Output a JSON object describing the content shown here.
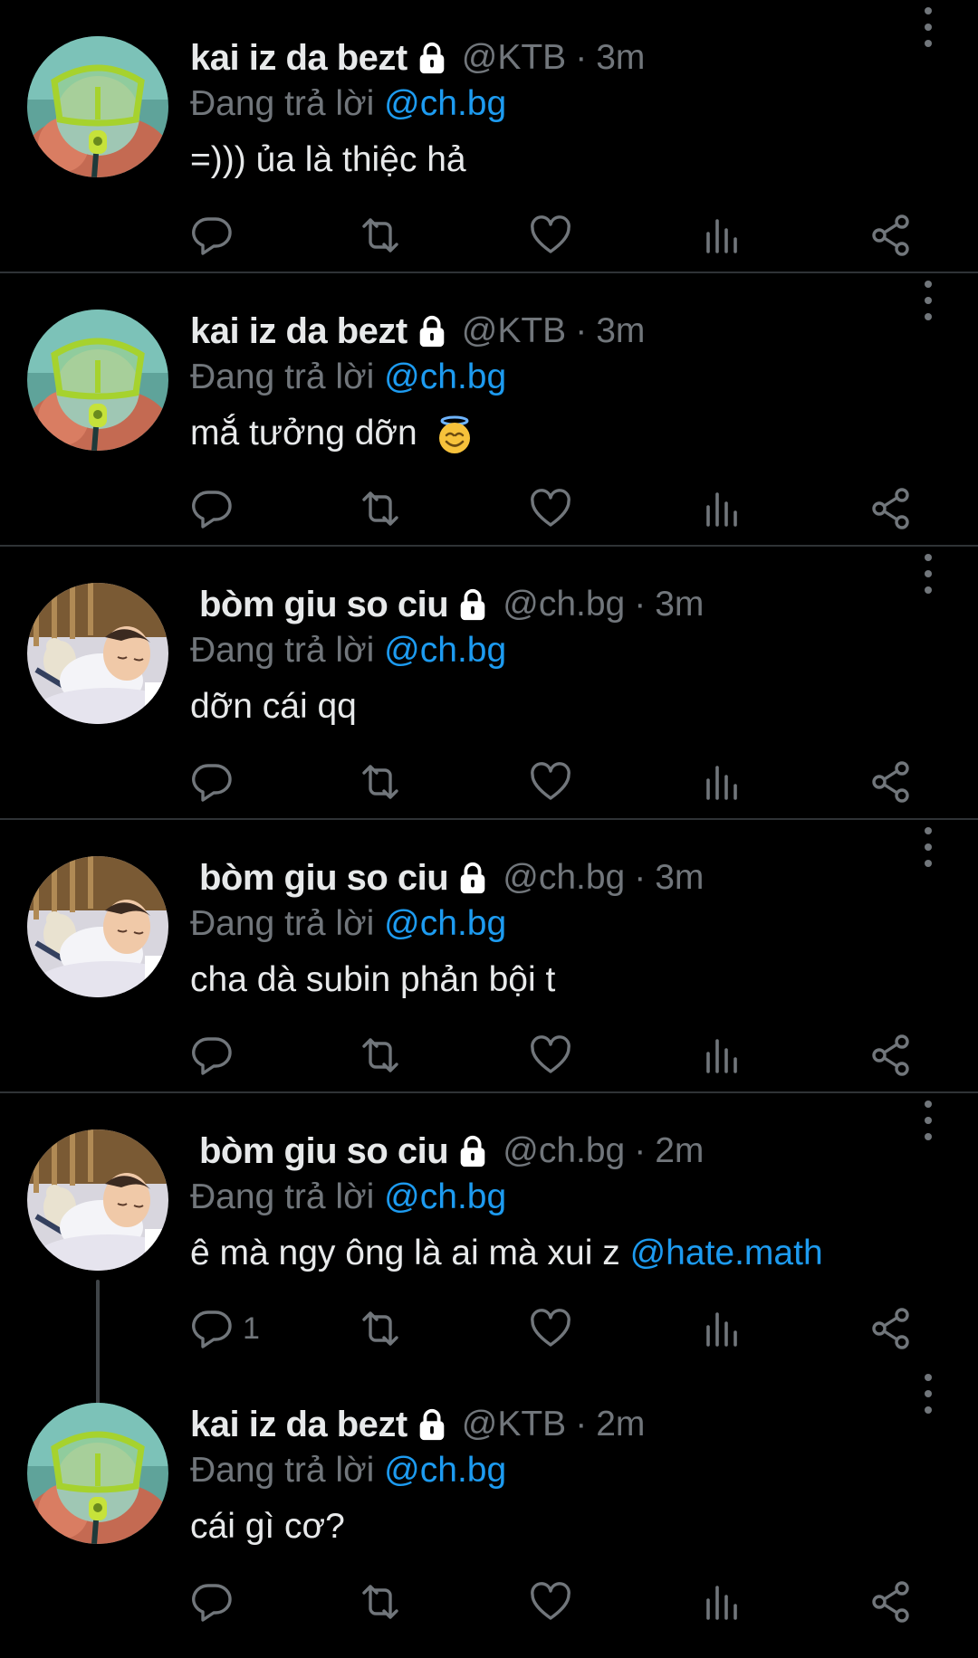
{
  "colors": {
    "background": "#000000",
    "text": "#e7e9ea",
    "muted": "#71767b",
    "accent": "#1d9bf0",
    "divider": "#2f3336"
  },
  "tweets": [
    {
      "display_name": "kai iz da bezt",
      "handle": "@KTB",
      "separator": "·",
      "time": "3m",
      "reply_prefix": "Đang trả lời",
      "reply_to": "@ch.bg",
      "text": "=))) ủa là thiệc hả",
      "reply_count": "",
      "avatar": "goggles-avatar",
      "lock_icon": "lock-icon"
    },
    {
      "display_name": "kai iz da bezt",
      "handle": "@KTB",
      "separator": "·",
      "time": "3m",
      "reply_prefix": "Đang trả lời",
      "reply_to": "@ch.bg",
      "text": "mắ tưởng dỡn",
      "emoji": "smiling-face-with-halo",
      "reply_count": "",
      "avatar": "goggles-avatar",
      "lock_icon": "lock-icon"
    },
    {
      "display_name": "bòm giu so ciu",
      "handle": "@ch.bg",
      "separator": "·",
      "time": "3m",
      "reply_prefix": "Đang trả lời",
      "reply_to": "@ch.bg",
      "text": "dỡn cái qq",
      "reply_count": "",
      "avatar": "sleeping-child-avatar",
      "lock_icon": "lock-icon"
    },
    {
      "display_name": "bòm giu so ciu",
      "handle": "@ch.bg",
      "separator": "·",
      "time": "3m",
      "reply_prefix": "Đang trả lời",
      "reply_to": "@ch.bg",
      "text": "cha dà subin phản bội t",
      "reply_count": "",
      "avatar": "sleeping-child-avatar",
      "lock_icon": "lock-icon"
    },
    {
      "display_name": "bòm giu so ciu",
      "handle": "@ch.bg",
      "separator": "·",
      "time": "2m",
      "reply_prefix": "Đang trả lời",
      "reply_to": "@ch.bg",
      "text": "ê mà ngy ông là ai mà xui z",
      "text_mention": "@hate.math",
      "reply_count": "1",
      "avatar": "sleeping-child-avatar",
      "lock_icon": "lock-icon"
    },
    {
      "display_name": "kai iz da bezt",
      "handle": "@KTB",
      "separator": "·",
      "time": "2m",
      "reply_prefix": "Đang trả lời",
      "reply_to": "@ch.bg",
      "text": "cái gì cơ?",
      "reply_count": "",
      "avatar": "goggles-avatar",
      "lock_icon": "lock-icon"
    }
  ],
  "action_icons": [
    "reply-icon",
    "retweet-icon",
    "like-icon",
    "views-icon",
    "share-icon"
  ]
}
